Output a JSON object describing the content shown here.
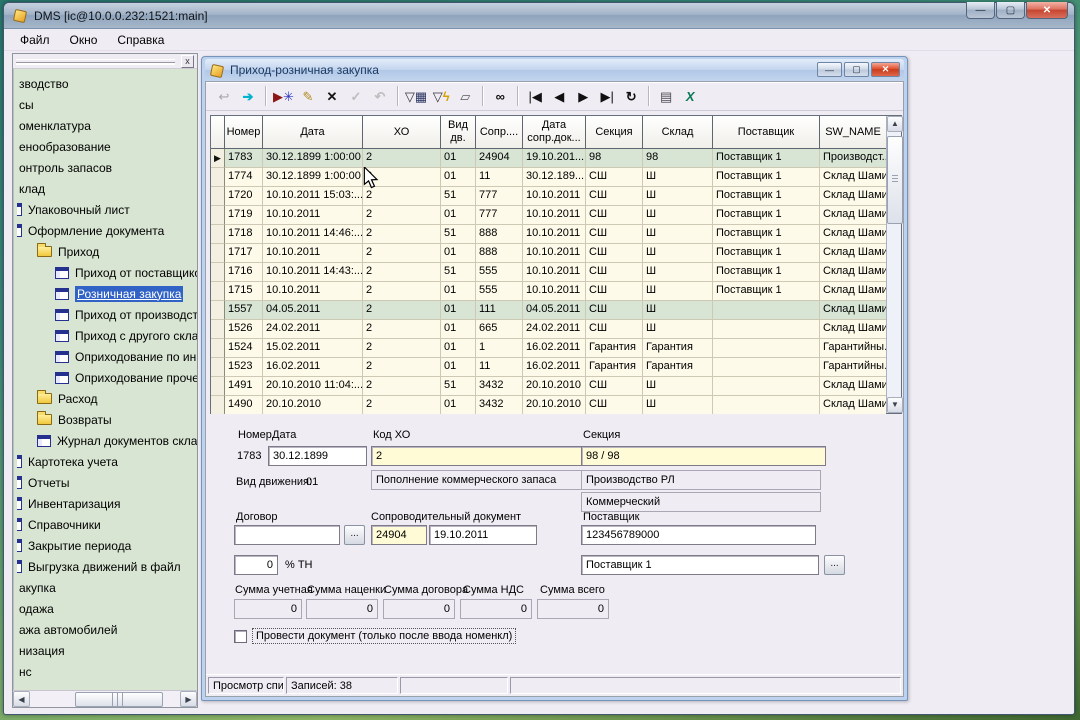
{
  "main_window": {
    "title": "DMS [ic@10.0.0.232:1521:main]",
    "controls": {
      "minimize": "—",
      "maximize": "▢",
      "close": "✕"
    }
  },
  "menu": {
    "items": [
      "Файл",
      "Окно",
      "Справка"
    ]
  },
  "sidebar": {
    "items": [
      {
        "label": "зводство",
        "level": 0,
        "icon": null,
        "selected": false
      },
      {
        "label": "сы",
        "level": 0,
        "icon": null,
        "selected": false
      },
      {
        "label": "оменклатура",
        "level": 0,
        "icon": null,
        "selected": false
      },
      {
        "label": "енообразование",
        "level": 0,
        "icon": null,
        "selected": false
      },
      {
        "label": "онтроль запасов",
        "level": 0,
        "icon": null,
        "selected": false
      },
      {
        "label": "клад",
        "level": 0,
        "icon": null,
        "selected": false
      },
      {
        "label": "Упаковочный лист",
        "level": 1,
        "icon": "clipped",
        "selected": false
      },
      {
        "label": "Оформление документа",
        "level": 1,
        "icon": "clipped",
        "selected": false
      },
      {
        "label": "Приход",
        "level": 2,
        "icon": "folder",
        "selected": false
      },
      {
        "label": "Приход от поставщиков",
        "level": 3,
        "icon": "form",
        "selected": false
      },
      {
        "label": "Розничная закупка",
        "level": 3,
        "icon": "form",
        "selected": true
      },
      {
        "label": "Приход от производства",
        "level": 3,
        "icon": "form",
        "selected": false
      },
      {
        "label": "Приход с другого склада",
        "level": 3,
        "icon": "form",
        "selected": false
      },
      {
        "label": "Оприходование по инвен",
        "level": 3,
        "icon": "form",
        "selected": false
      },
      {
        "label": "Оприходование прочее",
        "level": 3,
        "icon": "form",
        "selected": false
      },
      {
        "label": "Расход",
        "level": 2,
        "icon": "folder",
        "selected": false
      },
      {
        "label": "Возвраты",
        "level": 2,
        "icon": "folder",
        "selected": false
      },
      {
        "label": "Журнал документов склада",
        "level": 2,
        "icon": "form",
        "selected": false
      },
      {
        "label": "Картотека учета",
        "level": 1,
        "icon": "clipped",
        "selected": false
      },
      {
        "label": "Отчеты",
        "level": 1,
        "icon": "clipped",
        "selected": false
      },
      {
        "label": "Инвентаризация",
        "level": 1,
        "icon": "clipped",
        "selected": false
      },
      {
        "label": "Справочники",
        "level": 1,
        "icon": "clipped",
        "selected": false
      },
      {
        "label": "Закрытие периода",
        "level": 1,
        "icon": "clipped",
        "selected": false
      },
      {
        "label": "Выгрузка движений в файл",
        "level": 1,
        "icon": "clipped",
        "selected": false
      },
      {
        "label": "акупка",
        "level": 0,
        "icon": null,
        "selected": false
      },
      {
        "label": "одажа",
        "level": 0,
        "icon": null,
        "selected": false
      },
      {
        "label": "ажа автомобилей",
        "level": 0,
        "icon": null,
        "selected": false
      },
      {
        "label": "низация",
        "level": 0,
        "icon": null,
        "selected": false
      },
      {
        "label": "нс",
        "level": 0,
        "icon": null,
        "selected": false
      }
    ]
  },
  "child": {
    "title": "Приход-розничная закупка",
    "controls": {
      "minimize": "—",
      "maximize": "▢",
      "close": "✕"
    },
    "toolbar": [
      {
        "name": "return",
        "disabled": true,
        "icon": [
          {
            "t": "↩",
            "c": "#9c9c9c"
          }
        ]
      },
      {
        "name": "open-form",
        "icon": [
          {
            "t": "➔",
            "c": "#00b2cc",
            "b": true
          }
        ]
      },
      {
        "sep": true
      },
      {
        "name": "insert-record",
        "icon": [
          {
            "t": "▶",
            "c": "#8b1616"
          },
          {
            "t": "✳",
            "c": "#2a36c0"
          }
        ]
      },
      {
        "name": "edit-record",
        "icon": [
          {
            "t": "✎",
            "c": "#b08a20"
          }
        ]
      },
      {
        "name": "delete-record",
        "icon": [
          {
            "t": "✕",
            "c": "#141414",
            "b": true
          }
        ]
      },
      {
        "name": "post-record",
        "disabled": true,
        "icon": [
          {
            "t": "✓",
            "c": "#b5b5b5",
            "b": true
          }
        ]
      },
      {
        "name": "cancel-edit",
        "disabled": true,
        "icon": [
          {
            "t": "↶",
            "c": "#b5b5b5",
            "b": true
          }
        ]
      },
      {
        "sep": true
      },
      {
        "name": "filter-dialog",
        "icon": [
          {
            "t": "▽",
            "c": "#333333"
          },
          {
            "t": "▦",
            "c": "#29335e"
          }
        ]
      },
      {
        "name": "filter-quick",
        "icon": [
          {
            "t": "▽",
            "c": "#333333"
          },
          {
            "t": "ϟ",
            "c": "#d4a300",
            "b": true
          }
        ]
      },
      {
        "name": "filter-clear",
        "icon": [
          {
            "t": "▱",
            "c": "#5a5a5a"
          }
        ]
      },
      {
        "sep": true
      },
      {
        "name": "search",
        "icon": [
          {
            "t": "∞",
            "c": "#101010",
            "b": true
          }
        ]
      },
      {
        "sep": true
      },
      {
        "name": "nav-first",
        "icon": [
          {
            "t": "|◀",
            "c": "#101010"
          }
        ]
      },
      {
        "name": "nav-prior",
        "icon": [
          {
            "t": "◀",
            "c": "#101010"
          }
        ]
      },
      {
        "name": "nav-next",
        "icon": [
          {
            "t": "▶",
            "c": "#101010"
          }
        ]
      },
      {
        "name": "nav-last",
        "icon": [
          {
            "t": "▶|",
            "c": "#101010"
          }
        ]
      },
      {
        "name": "refresh",
        "icon": [
          {
            "t": "↻",
            "c": "#101010",
            "b": true
          }
        ]
      },
      {
        "sep": true
      },
      {
        "name": "print",
        "icon": [
          {
            "t": "▤",
            "c": "#4a4a52"
          }
        ]
      },
      {
        "name": "export-excel",
        "icon": [
          {
            "t": "X",
            "c": "#0a7a56",
            "b": true,
            "i": true
          }
        ]
      }
    ],
    "grid": {
      "columns": [
        "Номер",
        "Дата",
        "ХО",
        "Вид\nдв.",
        "Сопр....",
        "Дата\nсопр.док...",
        "Секция",
        "Склад",
        "Поставщик",
        "SW_NAME"
      ],
      "rows": [
        {
          "current": true,
          "highlight": true,
          "cells": [
            "1783",
            "30.12.1899 1:00:00",
            "2",
            "01",
            "24904",
            "19.10.201...",
            "98",
            "98",
            "Поставщик 1",
            "Производст..."
          ]
        },
        {
          "highlight": false,
          "cells": [
            "1774",
            "30.12.1899 1:00:00",
            "2",
            "01",
            "11",
            "30.12.189...",
            "СШ",
            "Ш",
            "Поставщик 1",
            "Склад Шамин"
          ]
        },
        {
          "highlight": false,
          "cells": [
            "1720",
            "10.10.2011 15:03:...",
            "2",
            "51",
            "777",
            "10.10.2011",
            "СШ",
            "Ш",
            "Поставщик 1",
            "Склад Шамин"
          ]
        },
        {
          "highlight": false,
          "cells": [
            "1719",
            "10.10.2011",
            "2",
            "01",
            "777",
            "10.10.2011",
            "СШ",
            "Ш",
            "Поставщик 1",
            "Склад Шамин"
          ]
        },
        {
          "highlight": false,
          "cells": [
            "1718",
            "10.10.2011 14:46:...",
            "2",
            "51",
            "888",
            "10.10.2011",
            "СШ",
            "Ш",
            "Поставщик 1",
            "Склад Шамин"
          ]
        },
        {
          "highlight": false,
          "cells": [
            "1717",
            "10.10.2011",
            "2",
            "01",
            "888",
            "10.10.2011",
            "СШ",
            "Ш",
            "Поставщик 1",
            "Склад Шамин"
          ]
        },
        {
          "highlight": false,
          "cells": [
            "1716",
            "10.10.2011 14:43:...",
            "2",
            "51",
            "555",
            "10.10.2011",
            "СШ",
            "Ш",
            "Поставщик 1",
            "Склад Шамин"
          ]
        },
        {
          "highlight": false,
          "cells": [
            "1715",
            "10.10.2011",
            "2",
            "01",
            "555",
            "10.10.2011",
            "СШ",
            "Ш",
            "Поставщик 1",
            "Склад Шамин"
          ]
        },
        {
          "highlight": true,
          "cells": [
            "1557",
            "04.05.2011",
            "2",
            "01",
            "111",
            "04.05.2011",
            "СШ",
            "Ш",
            "",
            "Склад Шамин"
          ]
        },
        {
          "highlight": false,
          "cells": [
            "1526",
            "24.02.2011",
            "2",
            "01",
            "665",
            "24.02.2011",
            "СШ",
            "Ш",
            "",
            "Склад Шамин"
          ]
        },
        {
          "highlight": false,
          "cells": [
            "1524",
            "15.02.2011",
            "2",
            "01",
            "1",
            "16.02.2011",
            "Гарантия",
            "Гарантия",
            "",
            "Гарантийны..."
          ]
        },
        {
          "highlight": false,
          "cells": [
            "1523",
            "16.02.2011",
            "2",
            "01",
            "11",
            "16.02.2011",
            "Гарантия",
            "Гарантия",
            "",
            "Гарантийны..."
          ]
        },
        {
          "highlight": false,
          "cells": [
            "1491",
            "20.10.2010 11:04:...",
            "2",
            "51",
            "3432",
            "20.10.2010",
            "СШ",
            "Ш",
            "",
            "Склад Шамин"
          ]
        },
        {
          "highlight": false,
          "cells": [
            "1490",
            "20.10.2010",
            "2",
            "01",
            "3432",
            "20.10.2010",
            "СШ",
            "Ш",
            "",
            "Склад Шамин"
          ]
        }
      ]
    },
    "form": {
      "labels": {
        "nomer": "Номер",
        "data": "Дата",
        "kod_ho": "Код ХО",
        "sekcia": "Секция",
        "vid_dv": "Вид движения:",
        "dogovor": "Договор",
        "soprovod": "Сопроводительный документ",
        "postavshik": "Поставщик",
        "tn": "% ТН",
        "s_uchet": "Сумма учетная",
        "s_nacenki": "Сумма наценки",
        "s_dogovora": "Сумма договора",
        "s_nds": "Сумма НДС",
        "s_vsego": "Сумма всего"
      },
      "values": {
        "nomer": "1783",
        "data": "30.12.1899",
        "kod_ho": "2",
        "kod_ho_name": "Пополнение коммерческого запаса",
        "vid_dv": "01",
        "sekcia": "98    / 98",
        "sekcia_name1": "Производство РЛ",
        "sekcia_name2": "Коммерческий",
        "dogovor": "",
        "sopr_num": "24904",
        "sopr_date": "19.10.2011",
        "postav_code": "123456789000",
        "tn": "0",
        "postav_name": "Поставщик 1",
        "s_uchet": "0",
        "s_nacenki": "0",
        "s_dogovora": "0",
        "s_nds": "0",
        "s_vsego": "0",
        "dots": "..."
      },
      "checkbox": {
        "label": "Провести документ (только после ввода номенкл)",
        "checked": false
      }
    },
    "status": {
      "panels": [
        "Просмотр списка за",
        "Записей: 38",
        "",
        ""
      ]
    }
  }
}
